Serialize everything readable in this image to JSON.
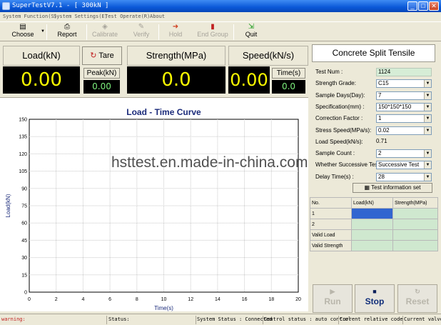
{
  "window": {
    "title": "SuperTestV7.1 - [ 300kN ]"
  },
  "menu": [
    "System Function(S)",
    "System Settings(E)",
    "Test Operate(R)",
    "About"
  ],
  "toolbar": {
    "choose": "Choose",
    "report": "Report",
    "calibrate": "Calibrate",
    "verify": "Verify",
    "hold": "Hold",
    "end_group": "End Group",
    "quit": "Quit"
  },
  "readouts": {
    "load_label": "Load(kN)",
    "load_value": "0.00",
    "tare_label": "Tare",
    "peak_label": "Peak(kN)",
    "peak_value": "0.00",
    "strength_label": "Strength(MPa)",
    "strength_value": "0.0",
    "speed_label": "Speed(kN/s)",
    "speed_value": "0.00",
    "time_label": "Time(s)",
    "time_value": "0.0"
  },
  "chart_data": {
    "type": "line",
    "title": "Load - Time Curve",
    "xlabel": "Time(s)",
    "ylabel": "Load(kN)",
    "xlim": [
      0,
      20
    ],
    "ylim": [
      0,
      150
    ],
    "x_ticks": [
      0,
      2,
      4,
      6,
      8,
      10,
      12,
      14,
      16,
      18,
      20
    ],
    "y_ticks": [
      0,
      15,
      30,
      45,
      60,
      75,
      90,
      105,
      120,
      135,
      150
    ],
    "grid": true,
    "series": []
  },
  "test_info": {
    "title": "Concrete Split Tensile",
    "fields": [
      {
        "label": "Test Num :",
        "value": "1124",
        "kind": "text"
      },
      {
        "label": "Strength Grade:",
        "value": "C15",
        "kind": "select"
      },
      {
        "label": "Sample Days(Day):",
        "value": "7",
        "kind": "select"
      },
      {
        "label": "Specification(mm) :",
        "value": "150*150*150",
        "kind": "select"
      },
      {
        "label": "Correction Factor :",
        "value": "1",
        "kind": "select"
      },
      {
        "label": "Stress Speed(MPa/s):",
        "value": "0.02",
        "kind": "select"
      },
      {
        "label": "Load Speed(kN/s):",
        "value": "0.71",
        "kind": "plain"
      },
      {
        "label": "Sample Count :",
        "value": "2",
        "kind": "select"
      },
      {
        "label": "Whether Successive Test:",
        "value": "Successive Test",
        "kind": "select"
      },
      {
        "label": "Delay Time(s) :",
        "value": "28",
        "kind": "select"
      }
    ],
    "info_button": "Test information set"
  },
  "results": {
    "headers": [
      "No.",
      "Load(kN)",
      "Strength(MPa)"
    ],
    "rows": [
      "1",
      "2",
      "Valid Load",
      "Valid Strength"
    ]
  },
  "actions": {
    "run": "Run",
    "stop": "Stop",
    "reset": "Reset"
  },
  "status": {
    "warning": "warning:",
    "status": "Status:",
    "system_status": "System Status : Connected",
    "control_status": "Control status : auto control",
    "relative_code": "Current relative code",
    "valve": "Current valve:"
  },
  "watermark": "hsttest.en.made-in-china.com"
}
